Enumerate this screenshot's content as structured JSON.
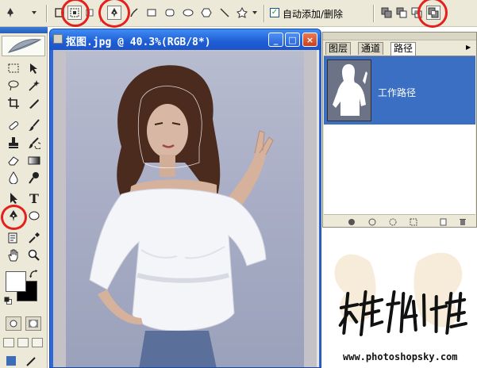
{
  "options_bar": {
    "auto_add_delete_label": "自动添加/删除",
    "auto_add_delete_checked": true,
    "check_mark": "✓"
  },
  "document": {
    "title": "抠图.jpg @ 40.3%(RGB/8*)",
    "minimize_glyph": "_",
    "maximize_glyph": "□",
    "close_glyph": "×"
  },
  "panel": {
    "tabs": [
      {
        "label": "图层",
        "active": false
      },
      {
        "label": "通道",
        "active": false
      },
      {
        "label": "路径",
        "active": true
      }
    ],
    "menu_glyph": "▶",
    "paths": [
      {
        "name": "工作路径",
        "selected": true
      }
    ]
  },
  "tools": {
    "text_tool_glyph": "T"
  },
  "watermark": {
    "url": "www.photoshopsky.com"
  },
  "colors": {
    "foreground": "#ffffff",
    "background": "#000000",
    "annotation_ring": "#e3201c",
    "selected_row": "#3a6fc4",
    "title_bar": "#2f68d6"
  }
}
